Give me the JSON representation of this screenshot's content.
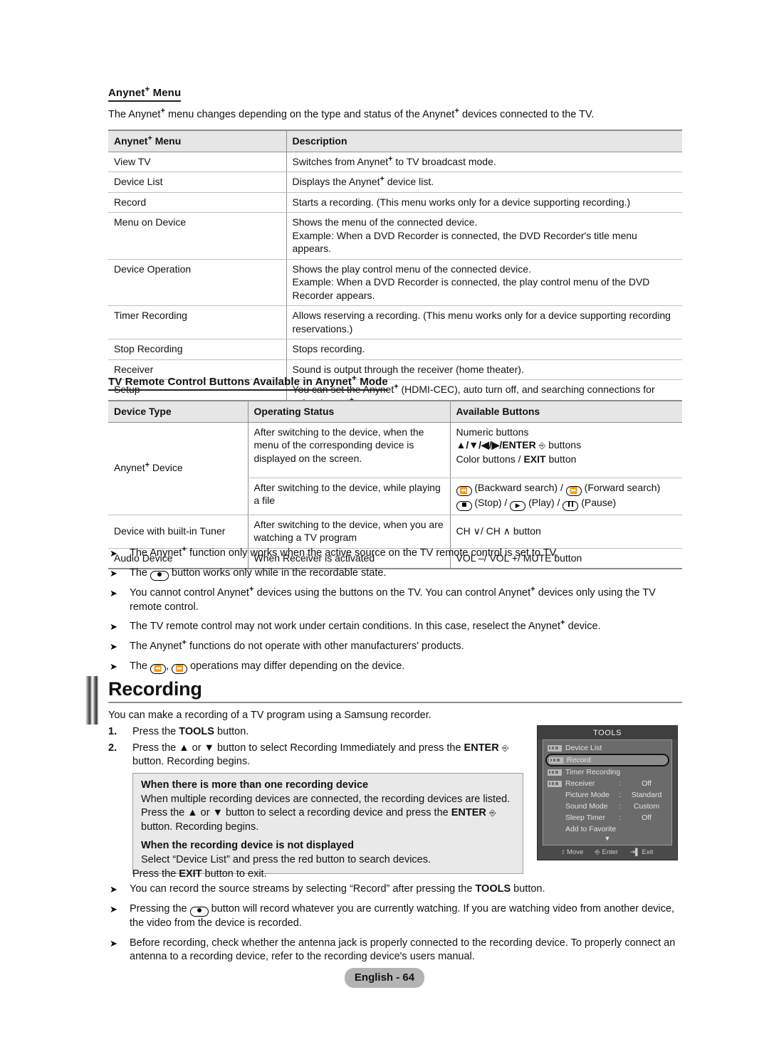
{
  "section1": {
    "heading": "Anynet+ Menu",
    "intro": "The Anynet+ menu changes depending on the type and status of the Anynet+ devices connected to the TV.",
    "table": {
      "headers": [
        "Anynet+ Menu",
        "Description"
      ],
      "rows": [
        {
          "menu": "View TV",
          "desc": "Switches from Anynet+ to TV broadcast mode."
        },
        {
          "menu": "Device List",
          "desc": "Displays the Anynet+ device list."
        },
        {
          "menu": "Record",
          "desc": "Starts a recording. (This menu works only for a device supporting recording.)"
        },
        {
          "menu": "Menu on Device",
          "desc": "Shows the menu of the connected device.\nExample: When a DVD Recorder is connected, the DVD Recorder's title menu appears."
        },
        {
          "menu": "Device Operation",
          "desc": "Shows the play control menu of the connected device.\nExample: When a DVD Recorder is connected, the play control menu of the DVD Recorder appears."
        },
        {
          "menu": "Timer Recording",
          "desc": "Allows reserving a recording. (This menu works only for a device supporting recording reservations.)"
        },
        {
          "menu": "Stop Recording",
          "desc": "Stops recording."
        },
        {
          "menu": "Receiver",
          "desc": "Sound is output through the receiver (home theater)."
        },
        {
          "menu": "Setup",
          "desc": "You can set the Anynet+ (HDMI-CEC), auto turn off, and searching connections for using Anynet+."
        }
      ]
    }
  },
  "section2": {
    "heading": "TV Remote Control Buttons Available in Anynet+ Mode",
    "table": {
      "headers": [
        "Device Type",
        "Operating Status",
        "Available Buttons"
      ],
      "rows": [
        {
          "device": "Anynet+ Device",
          "status": "After switching to the device, when the menu of the corresponding device is displayed on the screen.",
          "buttons_line1": "Numeric buttons",
          "buttons_line2": "/ / / /ENTER  buttons",
          "buttons_line3": "Color buttons / EXIT button"
        },
        {
          "device": "",
          "status": "After switching to the device, while playing a file",
          "buttons_line1": "(Backward search) /  (Forward search)",
          "buttons_line2": "(Stop) /  (Play) /  (Pause)"
        },
        {
          "device": "Device with built-in Tuner",
          "status": "After switching to the device, when you are watching a TV program",
          "buttons_line1": "CH  / CH  button"
        },
        {
          "device": "Audio Device",
          "status": "When Receiver is activated",
          "buttons_line1": "VOL  / VOL + / MUTE button"
        }
      ],
      "button_labels": {
        "numeric": "Numeric buttons",
        "enter_buttons": "buttons",
        "arrows": "▲/▼/◀/▶/ENTER",
        "color_exit_pre": "Color buttons /",
        "exit": "EXIT",
        "exit_post": "button",
        "backward": "(Backward search) /",
        "forward": "(Forward search)",
        "stop": "(Stop) /",
        "play": "(Play) /",
        "pause": "(Pause)",
        "ch": "CH ∨/ CH ∧ button",
        "vol": "VOL –/ VOL +/ MUTE button"
      }
    }
  },
  "notes_top": [
    "The Anynet+ function only works when the active source on the TV remote control is set to TV.",
    "The ⦿ button works only while in the recordable state.",
    "You cannot control Anynet+ devices using the buttons on the TV. You can control Anynet+ devices only using the TV remote control.",
    "The TV remote control may not work under certain conditions. In this case, reselect the Anynet+ device.",
    "The Anynet+ functions do not operate with other manufacturers' products.",
    "The ⏪, ⏩ operations may differ depending on the device."
  ],
  "recording": {
    "title": "Recording",
    "intro": "You can make a recording of a TV program using a Samsung recorder.",
    "steps": [
      {
        "num": "1.",
        "text": "Press the TOOLS button.",
        "bold": "TOOLS"
      },
      {
        "num": "2.",
        "text": "Press the ▲ or ▼ button to select Recording Immediately and press the ENTER  button. Recording begins.",
        "bold": "ENTER"
      }
    ],
    "notebox": {
      "head1": "When there is more than one recording device",
      "body1": "When multiple recording devices are connected, the recording devices are listed. Press the ▲ or ▼ button to select a recording device and press the ENTER  button. Recording begins.",
      "head2": "When the recording device is not displayed",
      "body2": "Select “Device List” and press the red button to search devices."
    },
    "exit_line": "Press the EXIT button to exit.",
    "exit_bold": "EXIT"
  },
  "notes_bottom": [
    "You can record the source streams by selecting “Record” after pressing the TOOLS button.",
    "Pressing the ⦿ button will record whatever you are currently watching. If you are watching video from another device, the video from the device is recorded.",
    "Before recording, check whether the antenna jack is properly connected to the recording device. To properly connect an antenna to a recording device, refer to the recording device's users manual."
  ],
  "osd": {
    "title": "TOOLS",
    "items": [
      {
        "label": "Device List",
        "badge": true,
        "colon": "",
        "value": "",
        "selected": false
      },
      {
        "label": "Record",
        "badge": true,
        "colon": "",
        "value": "",
        "selected": true
      },
      {
        "label": "Timer Recording",
        "badge": true,
        "colon": "",
        "value": "",
        "selected": false
      },
      {
        "label": "Receiver",
        "badge": true,
        "colon": ":",
        "value": "Off",
        "selected": false
      },
      {
        "label": "Picture Mode",
        "badge": false,
        "colon": ":",
        "value": "Standard",
        "selected": false
      },
      {
        "label": "Sound Mode",
        "badge": false,
        "colon": ":",
        "value": "Custom",
        "selected": false
      },
      {
        "label": "Sleep Timer",
        "badge": false,
        "colon": ":",
        "value": "Off",
        "selected": false
      },
      {
        "label": "Add to Favorite",
        "badge": false,
        "colon": "",
        "value": "",
        "selected": false
      }
    ],
    "more_indicator": "▼",
    "footer": {
      "move": "Move",
      "enter": "Enter",
      "exit": "Exit"
    }
  },
  "footer": {
    "page_label": "English - 64"
  },
  "colors": {
    "table_header_bg": "#e6e6e6",
    "rule": "#8d8d8d",
    "note_bg": "#e9e9e9",
    "osd_bg": "#4a4a4a",
    "osd_list_bg": "#6b6b6b",
    "osd_selected": "#8c8c8c",
    "footer_bg": "#b3b3b3"
  }
}
